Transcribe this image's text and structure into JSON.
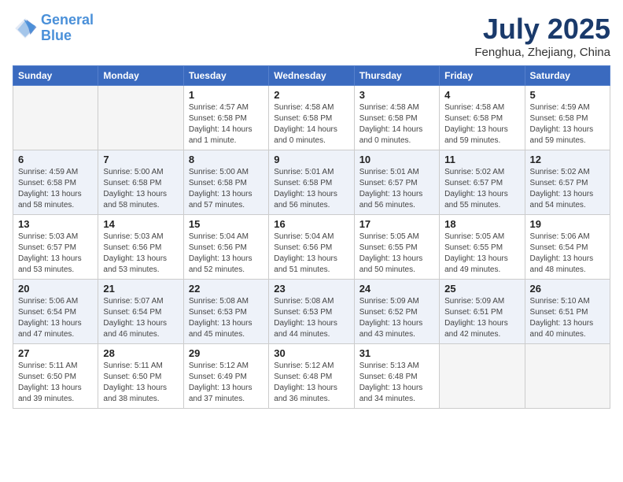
{
  "header": {
    "logo_general": "General",
    "logo_blue": "Blue",
    "month_title": "July 2025",
    "location": "Fenghua, Zhejiang, China"
  },
  "weekdays": [
    "Sunday",
    "Monday",
    "Tuesday",
    "Wednesday",
    "Thursday",
    "Friday",
    "Saturday"
  ],
  "weeks": [
    [
      {
        "day": "",
        "empty": true
      },
      {
        "day": "",
        "empty": true
      },
      {
        "day": "1",
        "sunrise": "4:57 AM",
        "sunset": "6:58 PM",
        "daylight": "14 hours and 1 minute."
      },
      {
        "day": "2",
        "sunrise": "4:58 AM",
        "sunset": "6:58 PM",
        "daylight": "14 hours and 0 minutes."
      },
      {
        "day": "3",
        "sunrise": "4:58 AM",
        "sunset": "6:58 PM",
        "daylight": "14 hours and 0 minutes."
      },
      {
        "day": "4",
        "sunrise": "4:58 AM",
        "sunset": "6:58 PM",
        "daylight": "13 hours and 59 minutes."
      },
      {
        "day": "5",
        "sunrise": "4:59 AM",
        "sunset": "6:58 PM",
        "daylight": "13 hours and 59 minutes."
      }
    ],
    [
      {
        "day": "6",
        "sunrise": "4:59 AM",
        "sunset": "6:58 PM",
        "daylight": "13 hours and 58 minutes."
      },
      {
        "day": "7",
        "sunrise": "5:00 AM",
        "sunset": "6:58 PM",
        "daylight": "13 hours and 58 minutes."
      },
      {
        "day": "8",
        "sunrise": "5:00 AM",
        "sunset": "6:58 PM",
        "daylight": "13 hours and 57 minutes."
      },
      {
        "day": "9",
        "sunrise": "5:01 AM",
        "sunset": "6:58 PM",
        "daylight": "13 hours and 56 minutes."
      },
      {
        "day": "10",
        "sunrise": "5:01 AM",
        "sunset": "6:57 PM",
        "daylight": "13 hours and 56 minutes."
      },
      {
        "day": "11",
        "sunrise": "5:02 AM",
        "sunset": "6:57 PM",
        "daylight": "13 hours and 55 minutes."
      },
      {
        "day": "12",
        "sunrise": "5:02 AM",
        "sunset": "6:57 PM",
        "daylight": "13 hours and 54 minutes."
      }
    ],
    [
      {
        "day": "13",
        "sunrise": "5:03 AM",
        "sunset": "6:57 PM",
        "daylight": "13 hours and 53 minutes."
      },
      {
        "day": "14",
        "sunrise": "5:03 AM",
        "sunset": "6:56 PM",
        "daylight": "13 hours and 53 minutes."
      },
      {
        "day": "15",
        "sunrise": "5:04 AM",
        "sunset": "6:56 PM",
        "daylight": "13 hours and 52 minutes."
      },
      {
        "day": "16",
        "sunrise": "5:04 AM",
        "sunset": "6:56 PM",
        "daylight": "13 hours and 51 minutes."
      },
      {
        "day": "17",
        "sunrise": "5:05 AM",
        "sunset": "6:55 PM",
        "daylight": "13 hours and 50 minutes."
      },
      {
        "day": "18",
        "sunrise": "5:05 AM",
        "sunset": "6:55 PM",
        "daylight": "13 hours and 49 minutes."
      },
      {
        "day": "19",
        "sunrise": "5:06 AM",
        "sunset": "6:54 PM",
        "daylight": "13 hours and 48 minutes."
      }
    ],
    [
      {
        "day": "20",
        "sunrise": "5:06 AM",
        "sunset": "6:54 PM",
        "daylight": "13 hours and 47 minutes."
      },
      {
        "day": "21",
        "sunrise": "5:07 AM",
        "sunset": "6:54 PM",
        "daylight": "13 hours and 46 minutes."
      },
      {
        "day": "22",
        "sunrise": "5:08 AM",
        "sunset": "6:53 PM",
        "daylight": "13 hours and 45 minutes."
      },
      {
        "day": "23",
        "sunrise": "5:08 AM",
        "sunset": "6:53 PM",
        "daylight": "13 hours and 44 minutes."
      },
      {
        "day": "24",
        "sunrise": "5:09 AM",
        "sunset": "6:52 PM",
        "daylight": "13 hours and 43 minutes."
      },
      {
        "day": "25",
        "sunrise": "5:09 AM",
        "sunset": "6:51 PM",
        "daylight": "13 hours and 42 minutes."
      },
      {
        "day": "26",
        "sunrise": "5:10 AM",
        "sunset": "6:51 PM",
        "daylight": "13 hours and 40 minutes."
      }
    ],
    [
      {
        "day": "27",
        "sunrise": "5:11 AM",
        "sunset": "6:50 PM",
        "daylight": "13 hours and 39 minutes."
      },
      {
        "day": "28",
        "sunrise": "5:11 AM",
        "sunset": "6:50 PM",
        "daylight": "13 hours and 38 minutes."
      },
      {
        "day": "29",
        "sunrise": "5:12 AM",
        "sunset": "6:49 PM",
        "daylight": "13 hours and 37 minutes."
      },
      {
        "day": "30",
        "sunrise": "5:12 AM",
        "sunset": "6:48 PM",
        "daylight": "13 hours and 36 minutes."
      },
      {
        "day": "31",
        "sunrise": "5:13 AM",
        "sunset": "6:48 PM",
        "daylight": "13 hours and 34 minutes."
      },
      {
        "day": "",
        "empty": true
      },
      {
        "day": "",
        "empty": true
      }
    ]
  ]
}
